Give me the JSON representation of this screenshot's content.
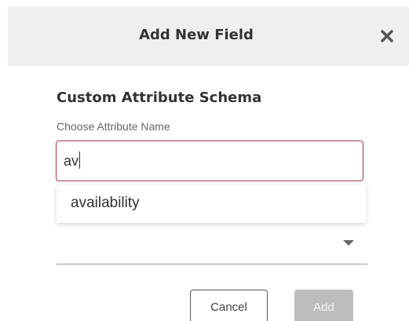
{
  "dialog": {
    "title": "Add New Field",
    "close_icon": "close-icon"
  },
  "form": {
    "section_title": "Custom Attribute Schema",
    "attribute_label": "Choose Attribute Name",
    "attribute_input_value": "av",
    "suggestions": [
      "availability"
    ],
    "select_icon": "chevron-down-icon"
  },
  "actions": {
    "cancel_label": "Cancel",
    "add_label": "Add"
  },
  "colors": {
    "input_border_focus": "#a83a42",
    "header_bg": "#efefef",
    "add_disabled_bg": "#bdbdbd"
  }
}
